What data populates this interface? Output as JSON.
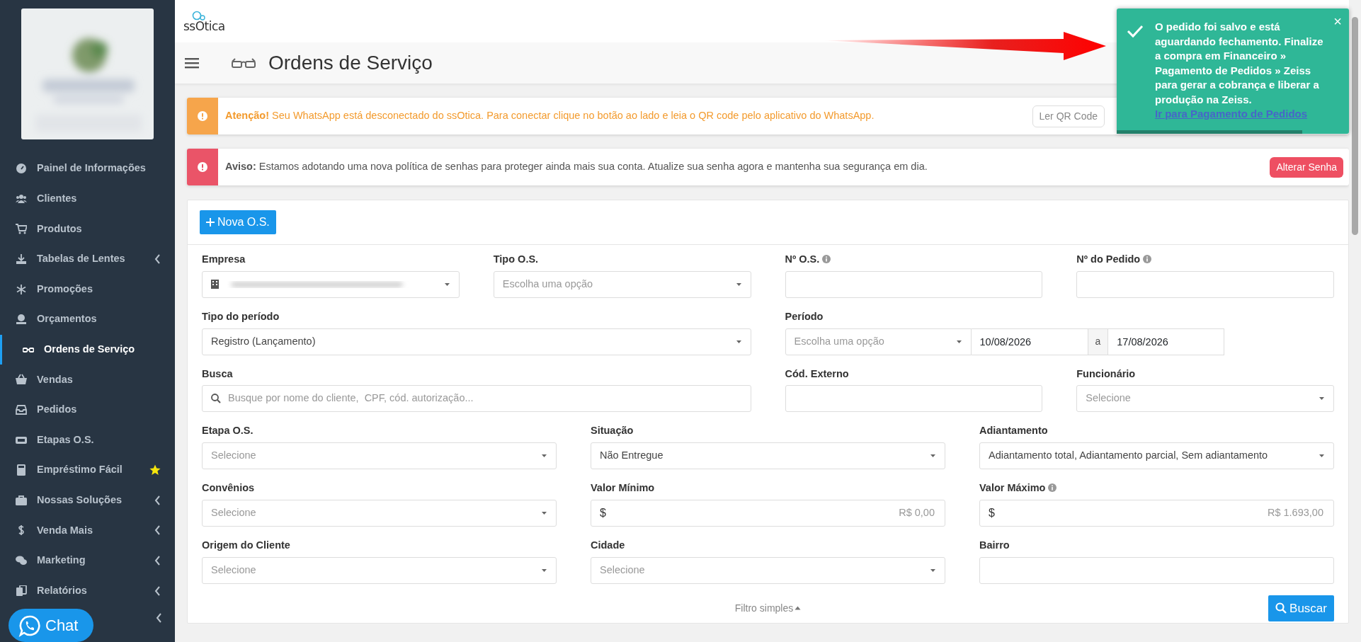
{
  "header": {
    "logo": "ssOtica",
    "page_title": "Ordens de Serviço"
  },
  "sidebar": {
    "items": [
      {
        "label": "Painel de Informações",
        "selected": false,
        "has_submenu": false,
        "starred": false
      },
      {
        "label": "Clientes",
        "selected": false,
        "has_submenu": false,
        "starred": false
      },
      {
        "label": "Produtos",
        "selected": false,
        "has_submenu": false,
        "starred": false
      },
      {
        "label": "Tabelas de Lentes",
        "selected": false,
        "has_submenu": true,
        "starred": false
      },
      {
        "label": "Promoções",
        "selected": false,
        "has_submenu": false,
        "starred": false
      },
      {
        "label": "Orçamentos",
        "selected": false,
        "has_submenu": false,
        "starred": false
      },
      {
        "label": "Ordens de Serviço",
        "selected": true,
        "has_submenu": false,
        "starred": false
      },
      {
        "label": "Vendas",
        "selected": false,
        "has_submenu": false,
        "starred": false
      },
      {
        "label": "Pedidos",
        "selected": false,
        "has_submenu": false,
        "starred": false
      },
      {
        "label": "Etapas O.S.",
        "selected": false,
        "has_submenu": false,
        "starred": false
      },
      {
        "label": "Empréstimo Fácil",
        "selected": false,
        "has_submenu": false,
        "starred": true
      },
      {
        "label": "Nossas Soluções",
        "selected": false,
        "has_submenu": true,
        "starred": false
      },
      {
        "label": "Venda Mais",
        "selected": false,
        "has_submenu": true,
        "starred": false
      },
      {
        "label": "Marketing",
        "selected": false,
        "has_submenu": true,
        "starred": false
      },
      {
        "label": "Relatórios",
        "selected": false,
        "has_submenu": true,
        "starred": false
      }
    ],
    "hidden_item": {
      "has_submenu": true
    }
  },
  "alerts": [
    {
      "kind": "warning",
      "text": "**Atenção!** Seu WhatsApp está desconectado do ssOtica. Para conectar clique no botão ao lado e leia o QR code pelo aplicativo do WhatsApp.",
      "button": "Ler QR Code"
    },
    {
      "kind": "danger",
      "text": "**Aviso:** Estamos adotando uma nova política de senhas para proteger ainda mais sua conta. Atualize sua senha agora e mantenha sua segurança em dia.",
      "button": "Alterar Senha"
    }
  ],
  "new_button": "Nova O.S.",
  "filters": [
    [
      {
        "label": "Empresa",
        "kind": "company",
        "info": false
      },
      {
        "label": "Tipo O.S.",
        "kind": "select",
        "placeholder": "Escolha uma opção",
        "info": false
      },
      {
        "label": "Nº O.S.",
        "kind": "input",
        "info": true
      },
      {
        "label": "Nº do Pedido",
        "kind": "input",
        "info": true
      }
    ],
    [
      {
        "label": "Tipo do período",
        "kind": "select",
        "value": "Registro (Lançamento)",
        "info": false
      },
      {
        "label": "Período",
        "kind": "period",
        "placeholder": "Escolha uma opção",
        "from": "10/08/2026",
        "separator": "a",
        "to": "17/08/2026",
        "info": false
      }
    ],
    [
      {
        "label": "Busca",
        "kind": "search",
        "placeholder": "Busque por nome do cliente,  CPF, cód. autorização...",
        "info": false
      },
      {
        "label": "Cód. Externo",
        "kind": "input",
        "info": false
      },
      {
        "label": "Funcionário",
        "kind": "select",
        "placeholder": "Selecione",
        "info": false
      }
    ],
    [
      {
        "label": "Etapa O.S.",
        "kind": "select",
        "placeholder": "Selecione",
        "info": false
      },
      {
        "label": "Situação",
        "kind": "select",
        "value": "Não Entregue",
        "info": false
      },
      {
        "label": "Adiantamento",
        "kind": "select",
        "value": "Adiantamento total, Adiantamento parcial, Sem adiantamento",
        "info": false
      }
    ],
    [
      {
        "label": "Convênios",
        "kind": "select",
        "placeholder": "Selecione",
        "info": false
      },
      {
        "label": "Valor Mínimo",
        "kind": "money",
        "prefix": "$",
        "placeholder": "R$ 0,00",
        "info": false
      },
      {
        "label": "Valor Máximo",
        "kind": "money",
        "prefix": "$",
        "placeholder": "R$ 1.693,00",
        "info": true
      }
    ],
    [
      {
        "label": "Origem do Cliente",
        "kind": "select",
        "placeholder": "Selecione",
        "info": false
      },
      {
        "label": "Cidade",
        "kind": "select",
        "placeholder": "Selecione",
        "info": false
      },
      {
        "label": "Bairro",
        "kind": "input",
        "info": false
      }
    ]
  ],
  "toggle_link": "Filtro simples",
  "search_button": "Buscar",
  "toast": {
    "text": "O pedido foi salvo e está aguardando fechamento. Finalize a compra em Financeiro » Pagamento de Pedidos » Zeiss para gerar a cobrança e liberar a produção na Zeiss.",
    "link": "Ir para Pagamento de Pedidos",
    "close": "×",
    "level": 0.8
  },
  "chat_button": "Chat"
}
